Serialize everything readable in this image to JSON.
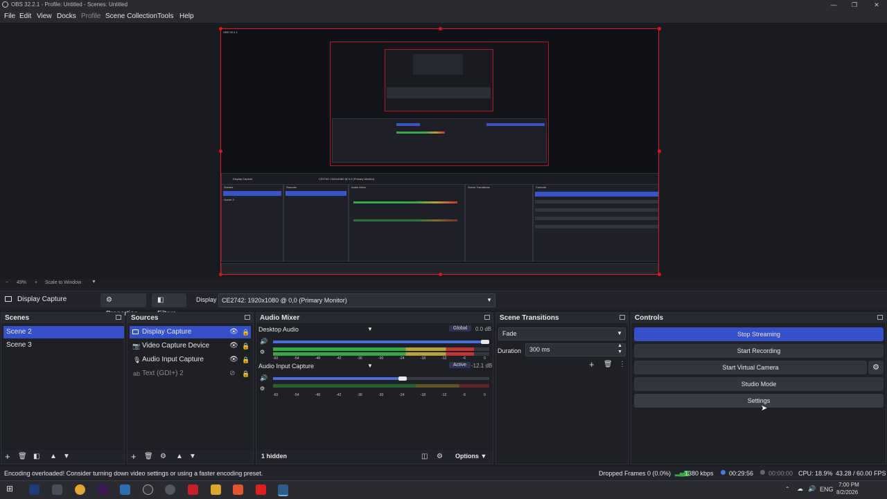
{
  "window": {
    "title": "OBS 32.2.1 - Profile: Untitled - Scenes: Untitled"
  },
  "menu": [
    "File",
    "Edit",
    "View",
    "Docks",
    "Profile",
    "Scene Collection",
    "Tools",
    "Help"
  ],
  "zoom": {
    "percent": "49%",
    "mode": "Scale to Window"
  },
  "source_toolbar": {
    "current": "Display Capture",
    "properties": "Properties",
    "filters": "Filters",
    "display_label": "Display",
    "display_value": "CE2742: 1920x1080 @ 0,0 (Primary Monitor)"
  },
  "scenes": {
    "title": "Scenes",
    "items": [
      "Scene 2",
      "Scene 3"
    ],
    "selected": 0
  },
  "sources": {
    "title": "Sources",
    "items": [
      {
        "label": "Display Capture",
        "icon": "monitor-icon"
      },
      {
        "label": "Video Capture Device",
        "icon": "camera-icon"
      },
      {
        "label": "Audio Input Capture",
        "icon": "microphone-icon"
      },
      {
        "label": "Text (GDI+) 2",
        "icon": "text-icon"
      }
    ],
    "selected": 0
  },
  "audio_mixer": {
    "title": "Audio Mixer",
    "channels": [
      {
        "name": "Desktop Audio",
        "tag": "Global",
        "db": "0.0 dB",
        "volume": 0.98,
        "level": 0.93
      },
      {
        "name": "Audio Input Capture",
        "tag": "Active",
        "db": "-12.1 dB",
        "volume": 0.6,
        "level": 0
      },
      {
        "name": "",
        "tag": "",
        "db": "",
        "volume": 0,
        "level": 0
      }
    ],
    "scale": [
      "-60",
      "-54",
      "-48",
      "-42",
      "-36",
      "-30",
      "-24",
      "-18",
      "-12",
      "-6",
      "0"
    ],
    "hidden": "1 hidden",
    "options": "Options"
  },
  "transitions": {
    "title": "Scene Transitions",
    "type": "Fade",
    "duration_label": "Duration",
    "duration": "300 ms"
  },
  "controls": {
    "title": "Controls",
    "buttons": [
      "Stop Streaming",
      "Start Recording",
      "Start Virtual Camera",
      "Studio Mode",
      "Settings"
    ]
  },
  "status": {
    "message": "Encoding overloaded! Consider turning down video settings or using a faster encoding preset.",
    "dropped": "Dropped Frames 0 (0.0%)",
    "bitrate": "1380 kbps",
    "stream_time": "00:29:56",
    "rec_time": "00:00:00",
    "cpu": "CPU: 18.9%",
    "fps": "43.28 / 60.00 FPS"
  },
  "taskbar": {
    "lang": "ENG",
    "time": "7:00 PM",
    "date": "8/2/2026"
  },
  "colors": {
    "accent": "#3650c9",
    "border_red": "#d71e27",
    "meter_green": "#37a845"
  }
}
